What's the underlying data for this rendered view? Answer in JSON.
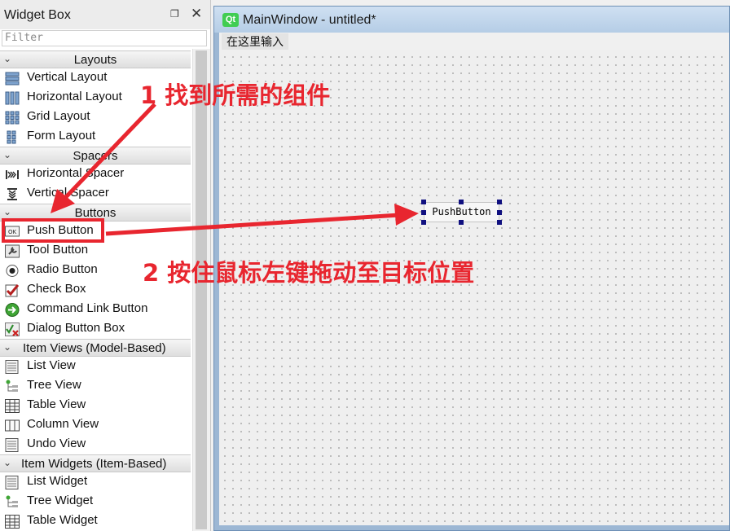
{
  "widget_box": {
    "title": "Widget Box",
    "float_icon": "float-icon",
    "close_icon": "close-icon",
    "filter_placeholder": "Filter",
    "categories": [
      {
        "label": "Layouts",
        "items": [
          {
            "label": "Vertical Layout",
            "icon": "vertical-layout-icon"
          },
          {
            "label": "Horizontal Layout",
            "icon": "horizontal-layout-icon"
          },
          {
            "label": "Grid Layout",
            "icon": "grid-layout-icon"
          },
          {
            "label": "Form Layout",
            "icon": "form-layout-icon"
          }
        ]
      },
      {
        "label": "Spacers",
        "items": [
          {
            "label": "Horizontal Spacer",
            "icon": "horizontal-spacer-icon"
          },
          {
            "label": "Vertical Spacer",
            "icon": "vertical-spacer-icon"
          }
        ]
      },
      {
        "label": "Buttons",
        "items": [
          {
            "label": "Push Button",
            "icon": "push-button-icon"
          },
          {
            "label": "Tool Button",
            "icon": "tool-button-icon"
          },
          {
            "label": "Radio Button",
            "icon": "radio-button-icon"
          },
          {
            "label": "Check Box",
            "icon": "check-box-icon"
          },
          {
            "label": "Command Link Button",
            "icon": "command-link-icon"
          },
          {
            "label": "Dialog Button Box",
            "icon": "dialog-button-box-icon"
          }
        ]
      },
      {
        "label": "Item Views (Model-Based)",
        "items": [
          {
            "label": "List View",
            "icon": "list-view-icon"
          },
          {
            "label": "Tree View",
            "icon": "tree-view-icon"
          },
          {
            "label": "Table View",
            "icon": "table-view-icon"
          },
          {
            "label": "Column View",
            "icon": "column-view-icon"
          },
          {
            "label": "Undo View",
            "icon": "undo-view-icon"
          }
        ]
      },
      {
        "label": "Item Widgets (Item-Based)",
        "items": [
          {
            "label": "List Widget",
            "icon": "list-widget-icon"
          },
          {
            "label": "Tree Widget",
            "icon": "tree-widget-icon"
          },
          {
            "label": "Table Widget",
            "icon": "table-widget-icon"
          }
        ]
      }
    ]
  },
  "main_window": {
    "title": "MainWindow - untitled*",
    "qt_badge": "Qt",
    "menu_placeholder": "在这里输入",
    "push_button_text": "PushButton"
  },
  "annotations": {
    "step1": "1 找到所需的组件",
    "step2": "2 按住鼠标左键拖动至目标位置",
    "color": "#e8262f"
  }
}
